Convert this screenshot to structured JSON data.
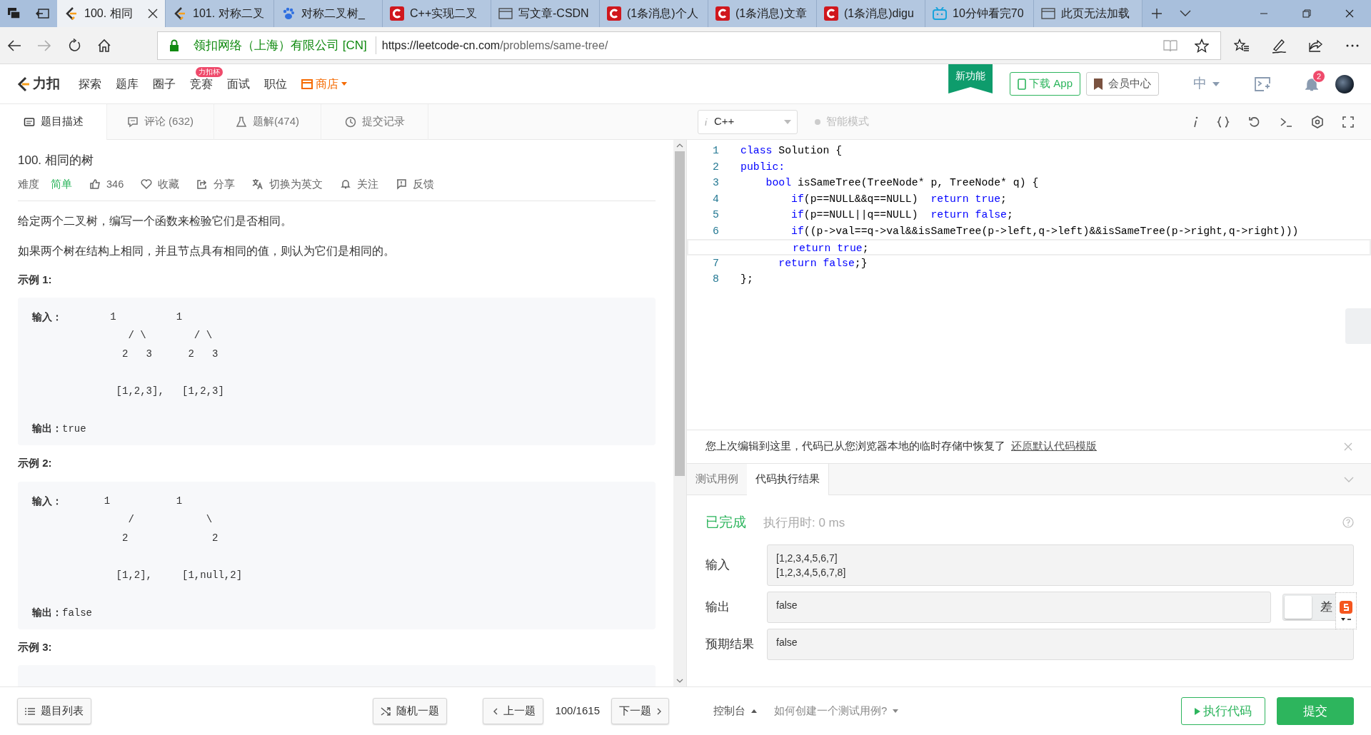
{
  "browser": {
    "tabs": [
      {
        "title": "100. 相同",
        "kind": "leetcode",
        "selected": true
      },
      {
        "title": "101. 对称二叉",
        "kind": "leetcode",
        "selected": false
      },
      {
        "title": "对称二叉树_",
        "kind": "baidu",
        "selected": false
      },
      {
        "title": "C++实现二叉",
        "kind": "csdn",
        "selected": false
      },
      {
        "title": "写文章-CSDN",
        "kind": "page",
        "selected": false
      },
      {
        "title": "(1条消息)个人",
        "kind": "csdn",
        "selected": false
      },
      {
        "title": "(1条消息)文章",
        "kind": "csdn",
        "selected": false
      },
      {
        "title": "(1条消息)digu",
        "kind": "csdn",
        "selected": false
      },
      {
        "title": "10分钟看完70",
        "kind": "bilibili",
        "selected": false
      },
      {
        "title": "此页无法加载",
        "kind": "page",
        "selected": false
      }
    ],
    "certificate": "领扣网络（上海）有限公司 [CN]",
    "url_host": "https://leetcode-cn.com",
    "url_path": "/problems/same-tree/"
  },
  "site_nav": {
    "logo": "力扣",
    "items": [
      {
        "label": "探索"
      },
      {
        "label": "题库"
      },
      {
        "label": "圈子"
      },
      {
        "label": "竞赛",
        "badge": "力扣杯"
      },
      {
        "label": "面试"
      },
      {
        "label": "职位"
      },
      {
        "label": "商店",
        "kind": "store"
      }
    ],
    "ribbon": "新功能",
    "download": "下载 App",
    "vip": "会员中心",
    "language": "中",
    "notifications": "2"
  },
  "problem_tabs": [
    {
      "label": "题目描述",
      "kind": "card",
      "selected": true
    },
    {
      "label": "评论 (632)",
      "kind": "comment",
      "selected": false
    },
    {
      "label": "题解(474)",
      "kind": "flask",
      "selected": false
    },
    {
      "label": "提交记录",
      "kind": "clock",
      "selected": false
    }
  ],
  "problem": {
    "title": "100. 相同的树",
    "difficulty_label": "难度",
    "difficulty": "简单",
    "actions": [
      {
        "label": "346",
        "kind": "thumb"
      },
      {
        "label": "收藏",
        "kind": "heart"
      },
      {
        "label": "分享",
        "kind": "share"
      },
      {
        "label": "切换为英文",
        "kind": "translate"
      },
      {
        "label": "关注",
        "kind": "bell"
      },
      {
        "label": "反馈",
        "kind": "feedback"
      }
    ],
    "paragraphs": [
      "给定两个二叉树，编写一个函数来检验它们是否相同。",
      "如果两个树在结构上相同，并且节点具有相同的值，则认为它们是相同的。"
    ],
    "examples": [
      {
        "title": "示例 1:",
        "input_label": "输入：",
        "input_art": "        1          1\n           / \\        / \\\n          2   3      2   3\n\n         [1,2,3],   [1,2,3]",
        "output_label": "输出：",
        "output": "true"
      },
      {
        "title": "示例 2:",
        "input_label": "输入：",
        "input_art": "       1           1\n           /            \\\n          2              2\n\n         [1,2],     [1,null,2]",
        "output_label": "输出：",
        "output": "false"
      },
      {
        "title": "示例 3:"
      }
    ]
  },
  "editor": {
    "language": "C++",
    "smart_mode": {
      "label": "智能模式",
      "on": false
    },
    "lines": [
      {
        "number": "1",
        "current": false,
        "segments": [
          {
            "text": "class",
            "kind": "keyword"
          },
          {
            "text": " Solution {",
            "kind": "plain"
          }
        ]
      },
      {
        "number": "2",
        "current": false,
        "segments": [
          {
            "text": "public:",
            "kind": "keyword"
          }
        ]
      },
      {
        "number": "3",
        "current": false,
        "segments": [
          {
            "text": "    bool",
            "kind": "keyword"
          },
          {
            "text": " isSameTree(TreeNode* p, TreeNode* q) {",
            "kind": "plain"
          }
        ]
      },
      {
        "number": "4",
        "current": false,
        "segments": [
          {
            "text": "        if",
            "kind": "keyword"
          },
          {
            "text": "(p==NULL&&q==NULL)  ",
            "kind": "plain"
          },
          {
            "text": "return true",
            "kind": "keyword"
          },
          {
            "text": ";",
            "kind": "plain"
          }
        ]
      },
      {
        "number": "5",
        "current": false,
        "segments": [
          {
            "text": "        if",
            "kind": "keyword"
          },
          {
            "text": "(p==NULL||q==NULL)  ",
            "kind": "plain"
          },
          {
            "text": "return false",
            "kind": "keyword"
          },
          {
            "text": ";",
            "kind": "plain"
          }
        ]
      },
      {
        "number": "6",
        "current": false,
        "segments": [
          {
            "text": "        if",
            "kind": "keyword"
          },
          {
            "text": "((p->val==q->val&&isSameTree(p->left,q->left)&&isSameTree(p->right,q->right)))",
            "kind": "plain"
          }
        ]
      },
      {
        "current": true,
        "segments": [
          {
            "text": "        return true",
            "kind": "keyword"
          },
          {
            "text": ";",
            "kind": "plain"
          }
        ]
      },
      {
        "number": "7",
        "current": false,
        "segments": [
          {
            "text": "      return false",
            "kind": "keyword"
          },
          {
            "text": ";}",
            "kind": "plain"
          }
        ]
      },
      {
        "number": "8",
        "current": false,
        "segments": [
          {
            "text": "};",
            "kind": "plain"
          }
        ]
      }
    ]
  },
  "notice": {
    "text": "您上次编辑到这里，代码已从您浏览器本地的临时存储中恢复了",
    "link": "还原默认代码模版"
  },
  "result_tabs": [
    {
      "label": "测试用例",
      "selected": false
    },
    {
      "label": "代码执行结果",
      "selected": true
    }
  ],
  "result": {
    "status": "已完成",
    "runtime": "执行用时: 0 ms",
    "fields": [
      {
        "label": "输入",
        "value": "[1,2,3,4,5,6,7]\n[1,2,3,4,5,6,7,8]"
      },
      {
        "label": "输出",
        "value": "false",
        "diff": "差"
      },
      {
        "label": "预期结果",
        "value": "false"
      }
    ]
  },
  "footer": {
    "list": "题目列表",
    "random": "随机一题",
    "prev": "上一题",
    "position": "100/1615",
    "next": "下一题",
    "console": "控制台",
    "howto": "如何创建一个测试用例?",
    "run": "执行代码",
    "submit": "提交"
  }
}
